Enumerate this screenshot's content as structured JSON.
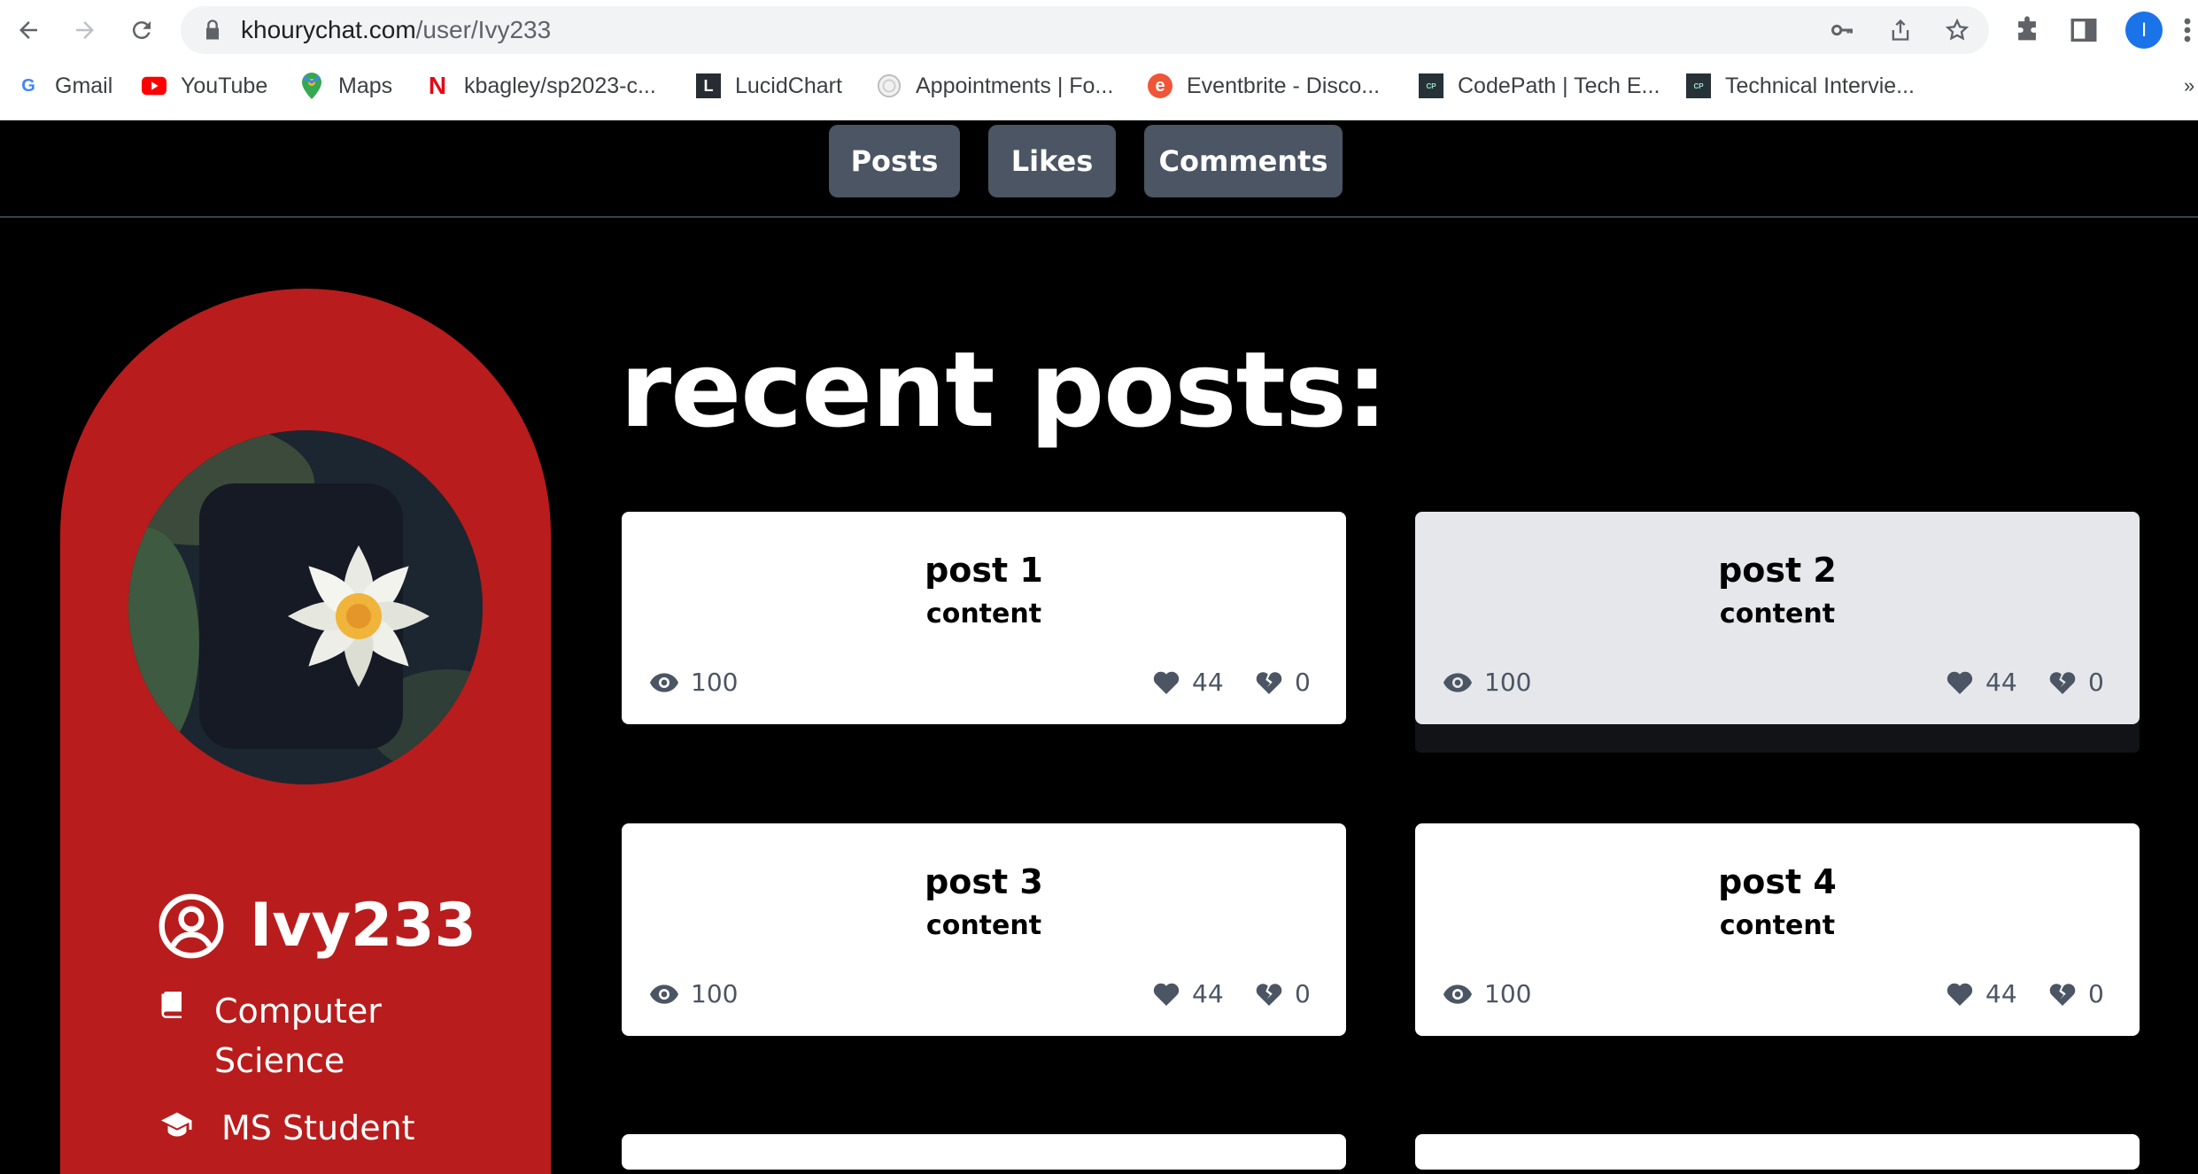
{
  "browser": {
    "url_domain": "khourychat.com",
    "url_path": "/user/Ivy233",
    "profile_initial": "I",
    "bookmarks": [
      {
        "label": "Gmail",
        "icon": "google-icon"
      },
      {
        "label": "YouTube",
        "icon": "youtube-icon"
      },
      {
        "label": "Maps",
        "icon": "maps-icon"
      },
      {
        "label": "kbagley/sp2023-c...",
        "icon": "netflix-icon"
      },
      {
        "label": "LucidChart",
        "icon": "lucidchart-icon"
      },
      {
        "label": "Appointments | Fo...",
        "icon": "seal-icon"
      },
      {
        "label": "Eventbrite - Disco...",
        "icon": "eventbrite-icon"
      },
      {
        "label": "CodePath | Tech E...",
        "icon": "codepath-icon"
      },
      {
        "label": "Technical Intervie...",
        "icon": "codepath-icon"
      }
    ],
    "bookmarks_overflow": "»"
  },
  "site_nav": {
    "tabs": [
      "Posts",
      "Likes",
      "Comments"
    ]
  },
  "profile": {
    "username": "Ivy233",
    "major": "Computer Science",
    "major_line1": "Computer",
    "major_line2": "Science",
    "degree": "MS Student"
  },
  "main": {
    "heading": "recent posts:",
    "posts": [
      {
        "title": "post 1",
        "content": "content",
        "views": "100",
        "likes": "44",
        "dislikes": "0"
      },
      {
        "title": "post 2",
        "content": "content",
        "views": "100",
        "likes": "44",
        "dislikes": "0"
      },
      {
        "title": "post 3",
        "content": "content",
        "views": "100",
        "likes": "44",
        "dislikes": "0"
      },
      {
        "title": "post 4",
        "content": "content",
        "views": "100",
        "likes": "44",
        "dislikes": "0"
      }
    ]
  },
  "colors": {
    "profile_bg": "#b91c1c",
    "tab_bg": "#4b5563",
    "page_bg": "#000000",
    "hovered_card_bg": "#e5e7eb"
  }
}
